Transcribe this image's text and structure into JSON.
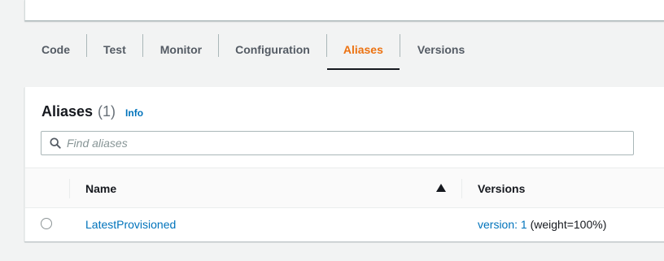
{
  "tabs": [
    {
      "label": "Code",
      "active": false
    },
    {
      "label": "Test",
      "active": false
    },
    {
      "label": "Monitor",
      "active": false
    },
    {
      "label": "Configuration",
      "active": false
    },
    {
      "label": "Aliases",
      "active": true
    },
    {
      "label": "Versions",
      "active": false
    }
  ],
  "aliases": {
    "title": "Aliases",
    "count": "(1)",
    "info_label": "Info",
    "search_placeholder": "Find aliases",
    "search_value": "",
    "columns": {
      "name": "Name",
      "versions": "Versions"
    },
    "sort_icon": "caret-up-icon",
    "rows": [
      {
        "name": "LatestProvisioned",
        "version_link": "version: 1",
        "version_weight": "(weight=100%)"
      }
    ]
  },
  "colors": {
    "accent_active_tab": "#ec7211",
    "link": "#0073bb",
    "text": "#16191f",
    "muted_text": "#545b64",
    "background": "#f2f3f3"
  }
}
